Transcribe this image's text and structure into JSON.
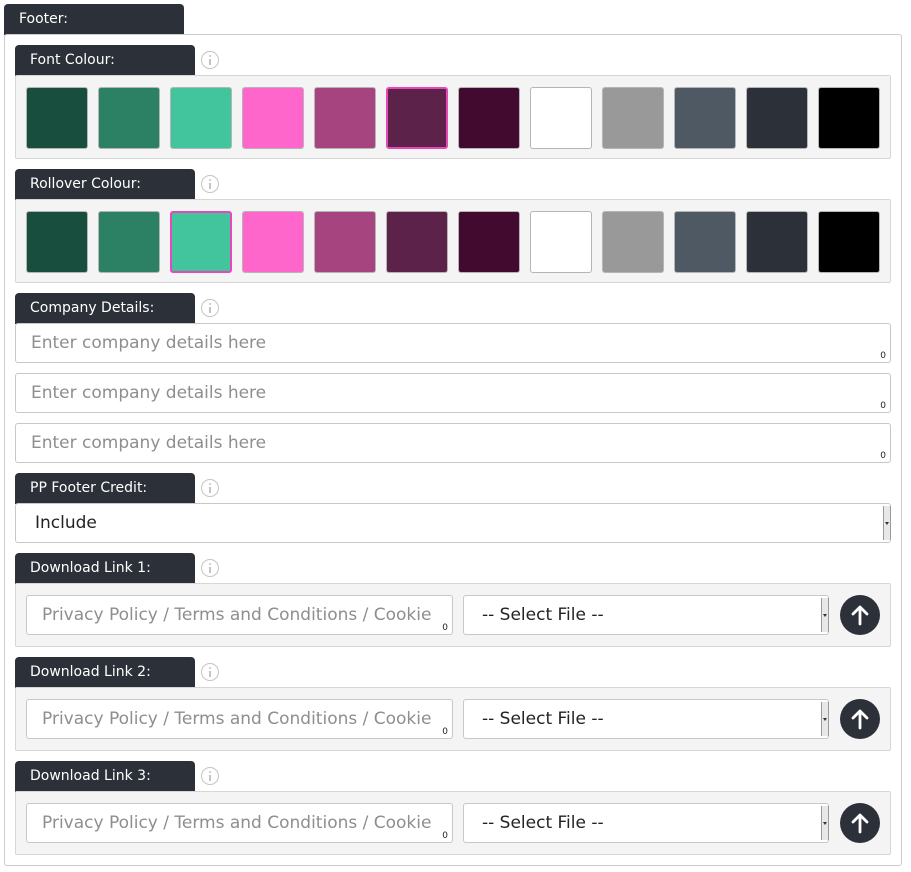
{
  "section": {
    "title": "Footer:"
  },
  "font_colour": {
    "label": "Font Colour:",
    "swatches": [
      "#184e3e",
      "#2c8063",
      "#42c59c",
      "#ff66cc",
      "#a5447f",
      "#5c2249",
      "#430a2f",
      "#ffffff",
      "#999999",
      "#4f5963",
      "#2c3038",
      "#000000"
    ],
    "selected_index": 5
  },
  "rollover_colour": {
    "label": "Rollover Colour:",
    "swatches": [
      "#184e3e",
      "#2c8063",
      "#42c59c",
      "#ff66cc",
      "#a5447f",
      "#5c2249",
      "#430a2f",
      "#ffffff",
      "#999999",
      "#4f5963",
      "#2c3038",
      "#000000"
    ],
    "selected_index": 2
  },
  "company_details": {
    "label": "Company Details:",
    "fields": [
      {
        "placeholder": "Enter company details here",
        "value": "",
        "count": "0"
      },
      {
        "placeholder": "Enter company details here",
        "value": "",
        "count": "0"
      },
      {
        "placeholder": "Enter company details here",
        "value": "",
        "count": "0"
      }
    ]
  },
  "pp_footer_credit": {
    "label": "PP Footer Credit:",
    "value": "Include"
  },
  "download_links": [
    {
      "label": "Download Link 1:",
      "placeholder": "Privacy Policy / Terms and Conditions / Cookie Policy",
      "count": "0",
      "file": "-- Select File --"
    },
    {
      "label": "Download Link 2:",
      "placeholder": "Privacy Policy / Terms and Conditions / Cookie Policy",
      "count": "0",
      "file": "-- Select File --"
    },
    {
      "label": "Download Link 3:",
      "placeholder": "Privacy Policy / Terms and Conditions / Cookie Policy",
      "count": "0",
      "file": "-- Select File --"
    }
  ]
}
